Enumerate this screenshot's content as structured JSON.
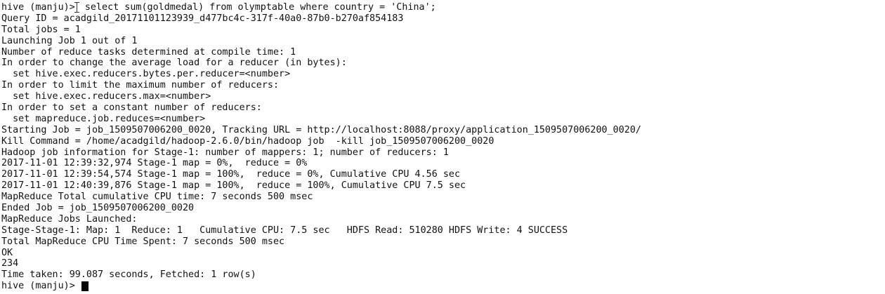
{
  "terminal": {
    "prompt": "hive (manju)>",
    "first_command": " select sum(goldmedal) from olymptable where country = 'China';",
    "output_lines": [
      "Query ID = acadgild_20171101123939_d477bc4c-317f-40a0-87b0-b270af854183",
      "Total jobs = 1",
      "Launching Job 1 out of 1",
      "Number of reduce tasks determined at compile time: 1",
      "In order to change the average load for a reducer (in bytes):",
      "  set hive.exec.reducers.bytes.per.reducer=<number>",
      "In order to limit the maximum number of reducers:",
      "  set hive.exec.reducers.max=<number>",
      "In order to set a constant number of reducers:",
      "  set mapreduce.job.reduces=<number>",
      "Starting Job = job_1509507006200_0020, Tracking URL = http://localhost:8088/proxy/application_1509507006200_0020/",
      "Kill Command = /home/acadgild/hadoop-2.6.0/bin/hadoop job  -kill job_1509507006200_0020",
      "Hadoop job information for Stage-1: number of mappers: 1; number of reducers: 1",
      "2017-11-01 12:39:32,974 Stage-1 map = 0%,  reduce = 0%",
      "2017-11-01 12:39:54,574 Stage-1 map = 100%,  reduce = 0%, Cumulative CPU 4.56 sec",
      "2017-11-01 12:40:39,876 Stage-1 map = 100%,  reduce = 100%, Cumulative CPU 7.5 sec",
      "MapReduce Total cumulative CPU time: 7 seconds 500 msec",
      "Ended Job = job_1509507006200_0020",
      "MapReduce Jobs Launched:",
      "Stage-Stage-1: Map: 1  Reduce: 1   Cumulative CPU: 7.5 sec   HDFS Read: 510280 HDFS Write: 4 SUCCESS",
      "Total MapReduce CPU Time Spent: 7 seconds 500 msec",
      "OK",
      "234",
      "Time taken: 99.087 seconds, Fetched: 1 row(s)"
    ],
    "final_prompt": "hive (manju)> "
  }
}
